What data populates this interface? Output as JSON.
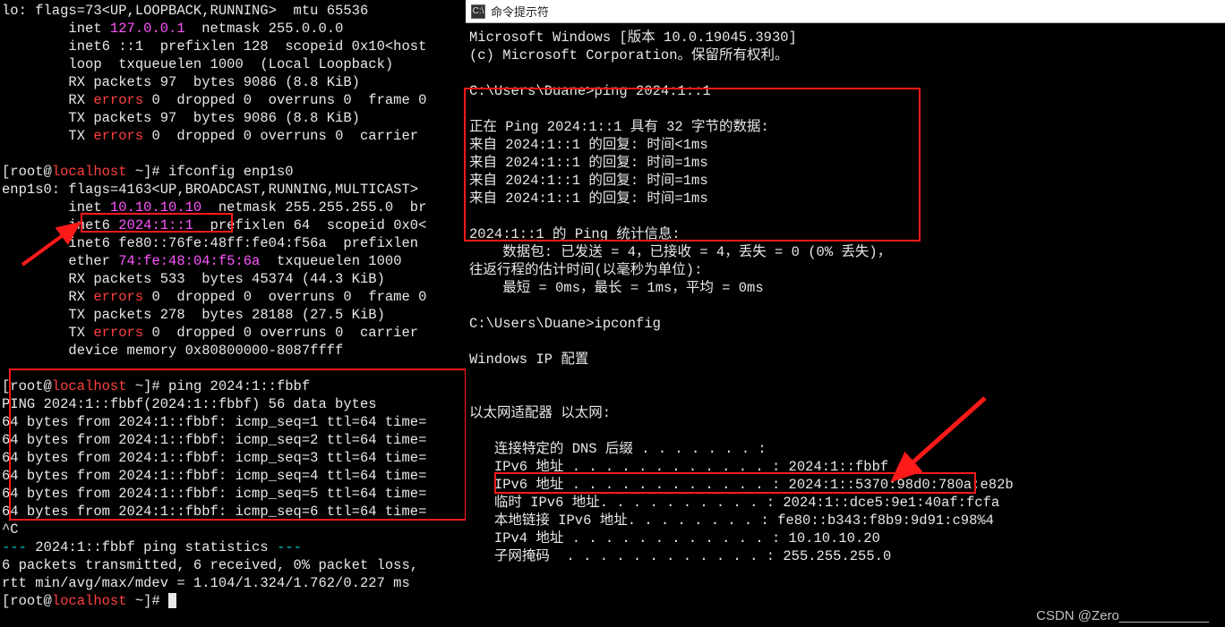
{
  "left": {
    "lines_top": [
      {
        "segs": [
          {
            "t": "lo: flags=73<UP,LOOPBACK,RUNNING>  mtu 65536",
            "c": "c-white"
          }
        ]
      },
      {
        "segs": [
          {
            "t": "        inet ",
            "c": "c-white"
          },
          {
            "t": "127.0.0.1",
            "c": "c-magenta"
          },
          {
            "t": "  netmask 255.0.0.0",
            "c": "c-white"
          }
        ]
      },
      {
        "segs": [
          {
            "t": "        inet6 ::1  prefixlen 128  scopeid 0x10<host",
            "c": "c-white"
          }
        ]
      },
      {
        "segs": [
          {
            "t": "        loop  txqueuelen 1000  (Local Loopback)",
            "c": "c-white"
          }
        ]
      },
      {
        "segs": [
          {
            "t": "        RX packets 97  bytes 9086 (8.8 KiB)",
            "c": "c-white"
          }
        ]
      },
      {
        "segs": [
          {
            "t": "        RX ",
            "c": "c-white"
          },
          {
            "t": "errors",
            "c": "c-red"
          },
          {
            "t": " 0  dropped 0  overruns 0  frame 0",
            "c": "c-white"
          }
        ]
      },
      {
        "segs": [
          {
            "t": "        TX packets 97  bytes 9086 (8.8 KiB)",
            "c": "c-white"
          }
        ]
      },
      {
        "segs": [
          {
            "t": "        TX ",
            "c": "c-white"
          },
          {
            "t": "errors",
            "c": "c-red"
          },
          {
            "t": " 0  dropped 0 overruns 0  carrier",
            "c": "c-white"
          }
        ]
      },
      {
        "segs": [
          {
            "t": " ",
            "c": "c-white"
          }
        ]
      },
      {
        "segs": [
          {
            "t": "[root@",
            "c": "c-white"
          },
          {
            "t": "localhost",
            "c": "c-red"
          },
          {
            "t": " ~]# ifconfig enp1s0",
            "c": "c-white"
          }
        ]
      },
      {
        "segs": [
          {
            "t": "enp1s0: flags=4163<UP,BROADCAST,RUNNING,MULTICAST>",
            "c": "c-white"
          }
        ]
      },
      {
        "segs": [
          {
            "t": "        inet ",
            "c": "c-white"
          },
          {
            "t": "10.10.10.10",
            "c": "c-magenta"
          },
          {
            "t": "  netmask 255.255.255.0  br",
            "c": "c-white"
          }
        ]
      },
      {
        "segs": [
          {
            "t": "        inet6 ",
            "c": "c-white"
          },
          {
            "t": "2024:1::1",
            "c": "c-magenta"
          },
          {
            "t": "  prefixlen 64  scopeid 0x0<",
            "c": "c-white"
          }
        ]
      },
      {
        "segs": [
          {
            "t": "        inet6 fe80::76fe:48ff:fe04:f56a  prefixlen",
            "c": "c-white"
          }
        ]
      },
      {
        "segs": [
          {
            "t": "        ether ",
            "c": "c-white"
          },
          {
            "t": "74:fe:48:04:f5:6a",
            "c": "c-magenta"
          },
          {
            "t": "  txqueuelen 1000",
            "c": "c-white"
          }
        ]
      },
      {
        "segs": [
          {
            "t": "        RX packets 533  bytes 45374 (44.3 KiB)",
            "c": "c-white"
          }
        ]
      },
      {
        "segs": [
          {
            "t": "        RX ",
            "c": "c-white"
          },
          {
            "t": "errors",
            "c": "c-red"
          },
          {
            "t": " 0  dropped 0  overruns 0  frame 0",
            "c": "c-white"
          }
        ]
      },
      {
        "segs": [
          {
            "t": "        TX packets 278  bytes 28188 (27.5 KiB)",
            "c": "c-white"
          }
        ]
      },
      {
        "segs": [
          {
            "t": "        TX ",
            "c": "c-white"
          },
          {
            "t": "errors",
            "c": "c-red"
          },
          {
            "t": " 0  dropped 0 overruns 0  carrier",
            "c": "c-white"
          }
        ]
      },
      {
        "segs": [
          {
            "t": "        device memory 0x80800000-8087ffff",
            "c": "c-white"
          }
        ]
      },
      {
        "segs": [
          {
            "t": " ",
            "c": "c-white"
          }
        ]
      },
      {
        "segs": [
          {
            "t": "[root@",
            "c": "c-white"
          },
          {
            "t": "localhost",
            "c": "c-red"
          },
          {
            "t": " ~]# ping 2024:1::fbbf",
            "c": "c-white"
          }
        ]
      },
      {
        "segs": [
          {
            "t": "PING 2024:1::fbbf(2024:1::fbbf) 56 data bytes",
            "c": "c-white"
          }
        ]
      },
      {
        "segs": [
          {
            "t": "64 bytes from 2024:1::fbbf: icmp_seq=1 ttl=64 time=",
            "c": "c-white"
          }
        ]
      },
      {
        "segs": [
          {
            "t": "64 bytes from 2024:1::fbbf: icmp_seq=2 ttl=64 time=",
            "c": "c-white"
          }
        ]
      },
      {
        "segs": [
          {
            "t": "64 bytes from 2024:1::fbbf: icmp_seq=3 ttl=64 time=",
            "c": "c-white"
          }
        ]
      },
      {
        "segs": [
          {
            "t": "64 bytes from 2024:1::fbbf: icmp_seq=4 ttl=64 time=",
            "c": "c-white"
          }
        ]
      },
      {
        "segs": [
          {
            "t": "64 bytes from 2024:1::fbbf: icmp_seq=5 ttl=64 time=",
            "c": "c-white"
          }
        ]
      },
      {
        "segs": [
          {
            "t": "64 bytes from 2024:1::fbbf: icmp_seq=6 ttl=64 time=",
            "c": "c-white"
          }
        ]
      },
      {
        "segs": [
          {
            "t": "^C",
            "c": "c-white"
          }
        ]
      },
      {
        "segs": [
          {
            "t": "--- ",
            "c": "c-cyan"
          },
          {
            "t": "2024:1::fbbf ping statistics",
            "c": "c-white"
          },
          {
            "t": " ---",
            "c": "c-cyan"
          }
        ]
      },
      {
        "segs": [
          {
            "t": "6 packets transmitted, 6 received, 0% packet loss,",
            "c": "c-white"
          }
        ]
      },
      {
        "segs": [
          {
            "t": "rtt min/avg/max/mdev = 1.104/1.324/1.762/0.227 ms",
            "c": "c-white"
          }
        ]
      },
      {
        "segs": [
          {
            "t": "[root@",
            "c": "c-white"
          },
          {
            "t": "localhost",
            "c": "c-red"
          },
          {
            "t": " ~]# ",
            "c": "c-white"
          }
        ],
        "cursor": true
      }
    ]
  },
  "right": {
    "title": "命令提示符",
    "lines": [
      "Microsoft Windows [版本 10.0.19045.3930]",
      "(c) Microsoft Corporation。保留所有权利。",
      "",
      "C:\\Users\\Duane>ping 2024:1::1",
      "",
      "正在 Ping 2024:1::1 具有 32 字节的数据:",
      "来自 2024:1::1 的回复: 时间<1ms",
      "来自 2024:1::1 的回复: 时间=1ms",
      "来自 2024:1::1 的回复: 时间=1ms",
      "来自 2024:1::1 的回复: 时间=1ms",
      "",
      "2024:1::1 的 Ping 统计信息:",
      "    数据包: 已发送 = 4，已接收 = 4，丢失 = 0 (0% 丢失)，",
      "往返行程的估计时间(以毫秒为单位):",
      "    最短 = 0ms，最长 = 1ms，平均 = 0ms",
      "",
      "C:\\Users\\Duane>ipconfig",
      "",
      "Windows IP 配置",
      "",
      "",
      "以太网适配器 以太网:",
      "",
      "   连接特定的 DNS 后缀 . . . . . . . :",
      "   IPv6 地址 . . . . . . . . . . . . : 2024:1::fbbf",
      "   IPv6 地址 . . . . . . . . . . . . : 2024:1::5370:98d0:780a:e82b",
      "   临时 IPv6 地址. . . . . . . . . . : 2024:1::dce5:9e1:40af:fcfa",
      "   本地链接 IPv6 地址. . . . . . . . : fe80::b343:f8b9:9d91:c98%4",
      "   IPv4 地址 . . . . . . . . . . . . : 10.10.10.20",
      "   子网掩码  . . . . . . . . . . . . : 255.255.255.0"
    ]
  },
  "watermark": "CSDN @Zero____________"
}
